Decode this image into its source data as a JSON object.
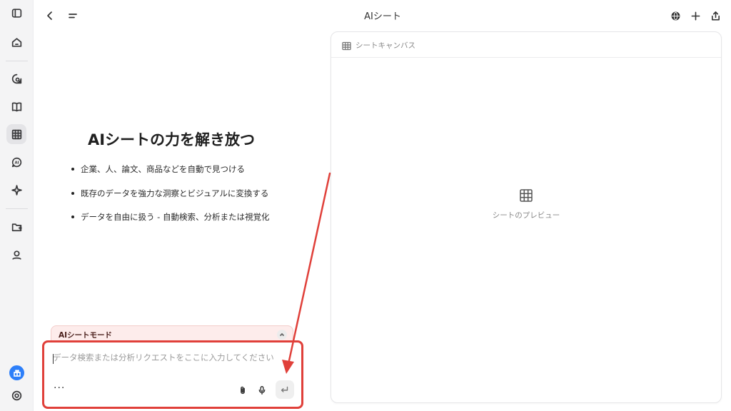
{
  "window": {
    "title": "AIシート"
  },
  "rail": {
    "items": [
      {
        "icon": "sidebar-toggle-icon"
      },
      {
        "icon": "home-icon"
      },
      {
        "icon": "chat-search-icon"
      },
      {
        "icon": "book-icon"
      },
      {
        "icon": "sheet-grid-icon",
        "active": true
      },
      {
        "icon": "ai-chat-icon"
      },
      {
        "icon": "sparkle-icon"
      },
      {
        "icon": "folder-plus-icon"
      },
      {
        "icon": "profile-icon"
      },
      {
        "icon": "gift-icon"
      },
      {
        "icon": "settings-icon"
      }
    ]
  },
  "topbar": {
    "left": [
      "back-icon",
      "menu-icon"
    ],
    "right": [
      "globe-icon",
      "plus-icon",
      "share-icon"
    ]
  },
  "hero": {
    "title": "AIシートの力を解き放つ",
    "features": [
      "企業、人、論文、商品などを自動で見つける",
      "既存のデータを強力な洞察とビジュアルに変換する",
      "データを自由に扱う - 自動検索、分析または視覚化"
    ]
  },
  "mode_banner": {
    "label": "AIシートモード"
  },
  "input": {
    "placeholder": "データ検索または分析リクエストをここに入力してください",
    "value": "",
    "more_label": "···"
  },
  "canvas": {
    "header_label": "シートキャンバス",
    "preview_label": "シートのプレビュー"
  },
  "colors": {
    "annotation": "#e0403a",
    "accent": "#2d7ff9",
    "banner_bg": "#fdeceb"
  }
}
